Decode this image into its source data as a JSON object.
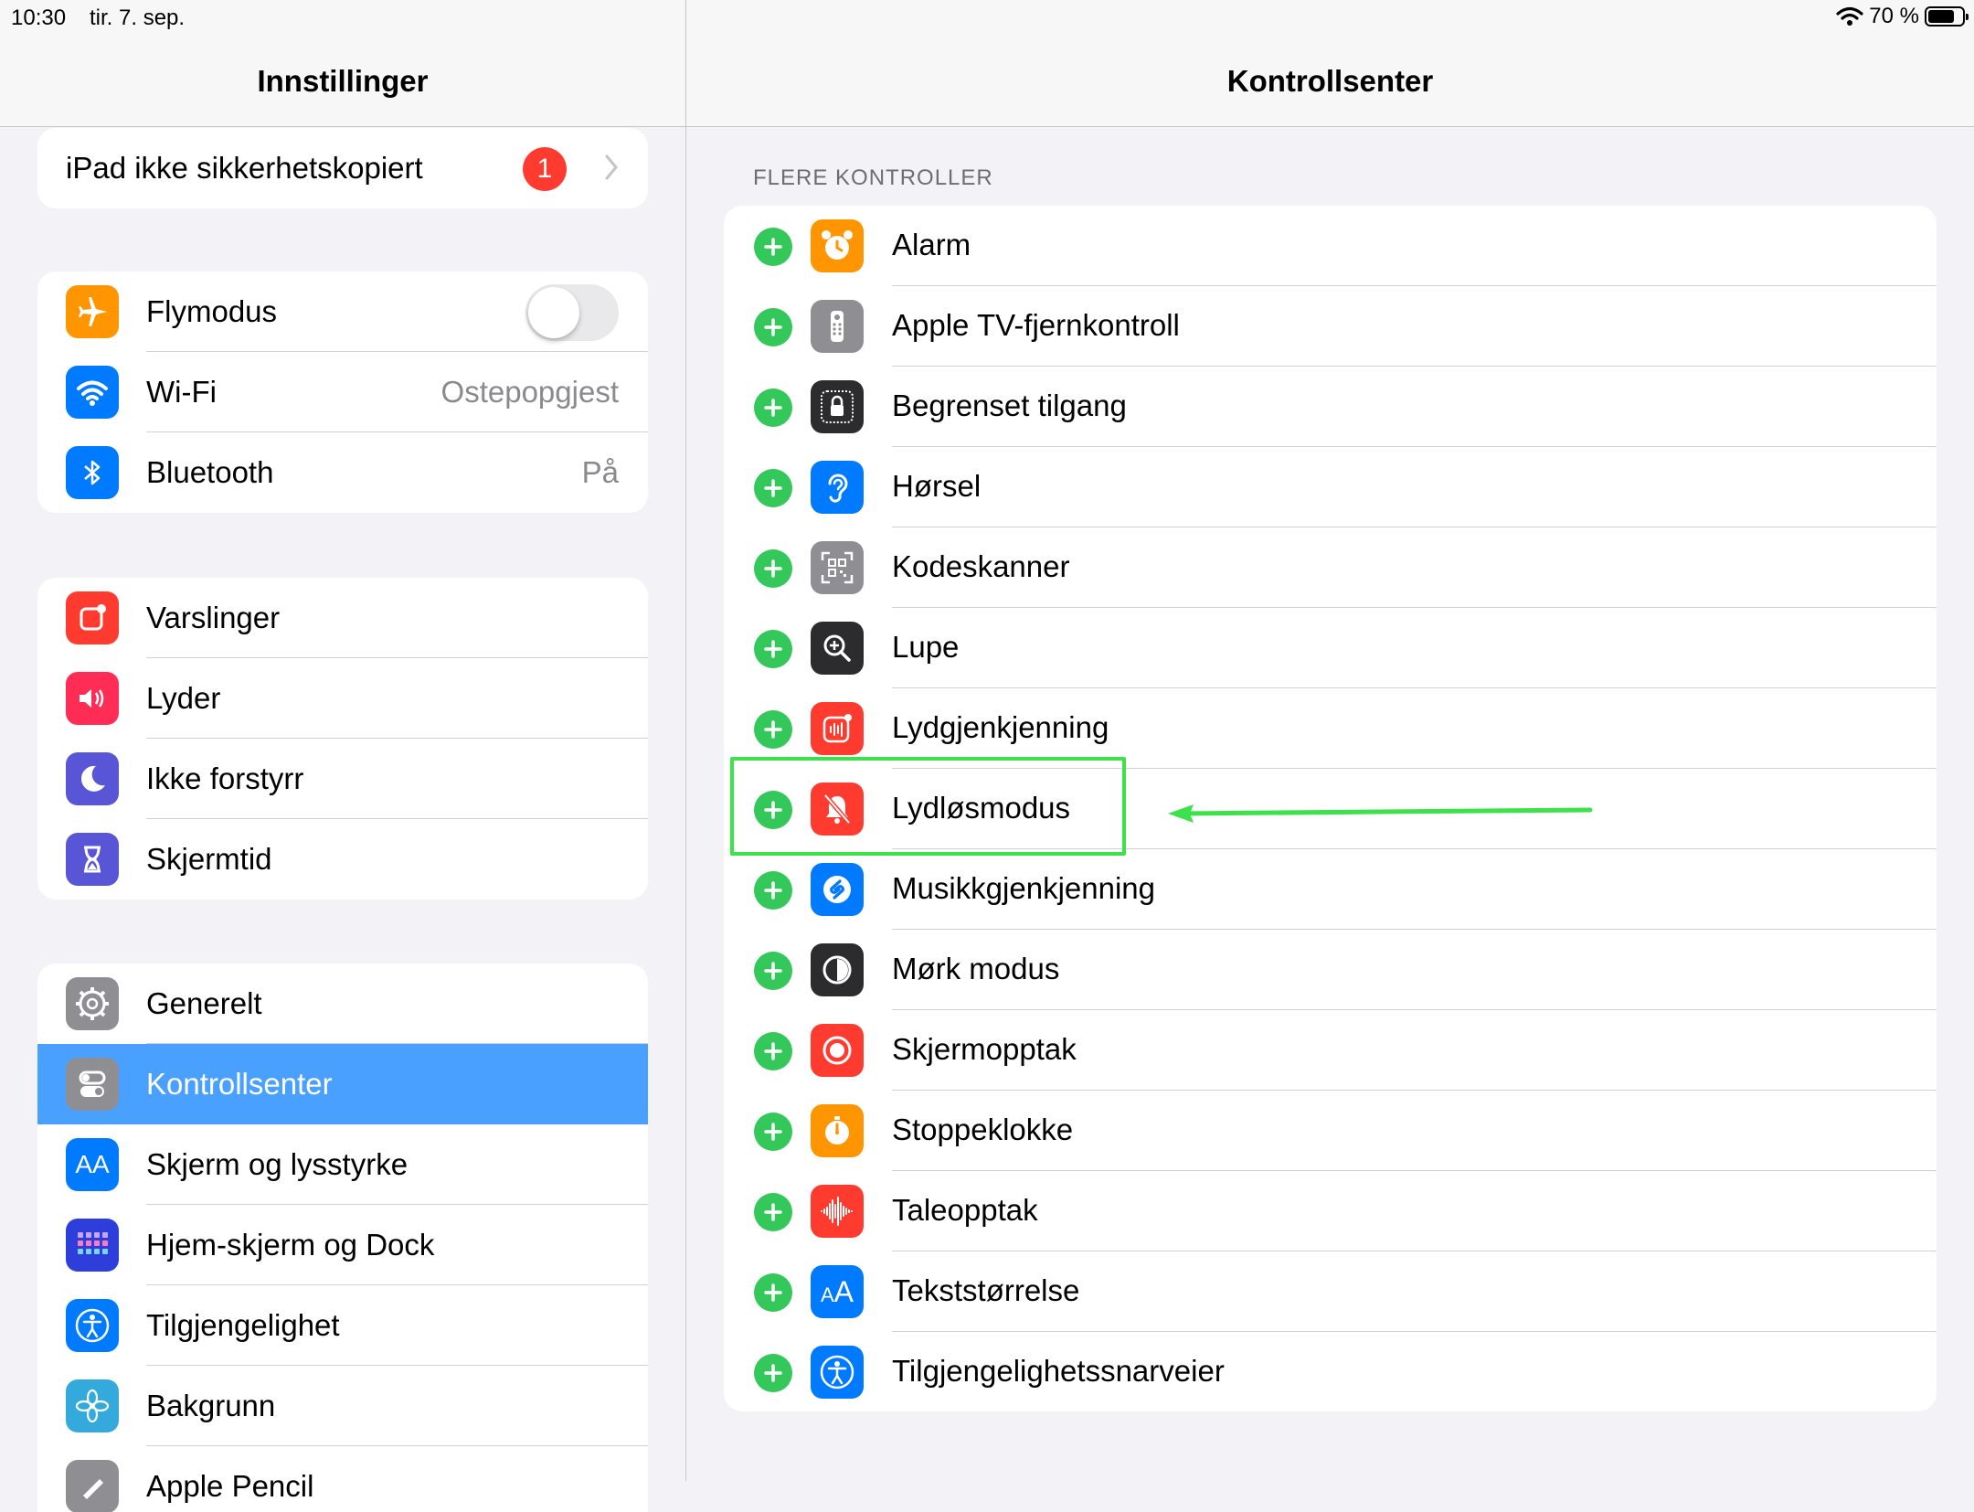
{
  "status": {
    "time": "10:30",
    "date": "tir. 7. sep.",
    "battery": "70 %"
  },
  "left": {
    "title": "Innstillinger",
    "backup": {
      "label": "iPad ikke sikkerhetskopiert",
      "badge": "1"
    },
    "connectivity": [
      {
        "label": "Flymodus",
        "icon": "airplane-icon",
        "color": "#ff9500"
      },
      {
        "label": "Wi-Fi",
        "value": "Ostepopgjest",
        "icon": "wifi-icon",
        "color": "#007aff"
      },
      {
        "label": "Bluetooth",
        "value": "På",
        "icon": "bluetooth-icon",
        "color": "#007aff"
      }
    ],
    "notifications": [
      {
        "label": "Varslinger",
        "icon": "notifications-icon",
        "color": "#ff3b30"
      },
      {
        "label": "Lyder",
        "icon": "speaker-icon",
        "color": "#ff2d55"
      },
      {
        "label": "Ikke forstyrr",
        "icon": "moon-icon",
        "color": "#5856d6"
      },
      {
        "label": "Skjermtid",
        "icon": "hourglass-icon",
        "color": "#5856d6"
      }
    ],
    "general": [
      {
        "label": "Generelt",
        "icon": "gear-icon",
        "color": "#8e8e93"
      },
      {
        "label": "Kontrollsenter",
        "icon": "switches-icon",
        "color": "#8e8e93"
      },
      {
        "label": "Skjerm og lysstyrke",
        "icon": "text-size-icon",
        "color": "#007aff"
      },
      {
        "label": "Hjem-skjerm og Dock",
        "icon": "grid-icon",
        "color": "#2d3edb"
      },
      {
        "label": "Tilgjengelighet",
        "icon": "accessibility-icon",
        "color": "#007aff"
      },
      {
        "label": "Bakgrunn",
        "icon": "flower-icon",
        "color": "#34aadc"
      },
      {
        "label": "Apple Pencil",
        "icon": "pencil-icon",
        "color": "#8e8e93"
      }
    ],
    "selected": "Kontrollsenter"
  },
  "right": {
    "title": "Kontrollsenter",
    "section": "FLERE KONTROLLER",
    "items": [
      {
        "label": "Alarm",
        "icon": "alarm-icon",
        "color": "#ff9500"
      },
      {
        "label": "Apple TV-fjernkontroll",
        "icon": "remote-icon",
        "color": "#8e8e93"
      },
      {
        "label": "Begrenset tilgang",
        "icon": "lock-icon",
        "color": "#2c2c2e"
      },
      {
        "label": "Hørsel",
        "icon": "ear-icon",
        "color": "#007aff"
      },
      {
        "label": "Kodeskanner",
        "icon": "qr-icon",
        "color": "#8e8e93"
      },
      {
        "label": "Lupe",
        "icon": "magnifier-icon",
        "color": "#2c2c2e"
      },
      {
        "label": "Lydgjenkjenning",
        "icon": "sound-recognition-icon",
        "color": "#ff3b30"
      },
      {
        "label": "Lydløsmodus",
        "icon": "bell-slash-icon",
        "color": "#ff3b30"
      },
      {
        "label": "Musikkgjenkjenning",
        "icon": "shazam-icon",
        "color": "#007aff"
      },
      {
        "label": "Mørk modus",
        "icon": "dark-mode-icon",
        "color": "#2c2c2e"
      },
      {
        "label": "Skjermopptak",
        "icon": "record-icon",
        "color": "#ff3b30"
      },
      {
        "label": "Stoppeklokke",
        "icon": "stopwatch-icon",
        "color": "#ff9500"
      },
      {
        "label": "Taleopptak",
        "icon": "waveform-icon",
        "color": "#ff3b30"
      },
      {
        "label": "Tekststørrelse",
        "icon": "text-size-icon",
        "color": "#007aff"
      },
      {
        "label": "Tilgjengelighetssnarveier",
        "icon": "accessibility-icon",
        "color": "#007aff"
      }
    ],
    "highlighted": "Lydløsmodus",
    "annotation_color": "#3de24a"
  }
}
